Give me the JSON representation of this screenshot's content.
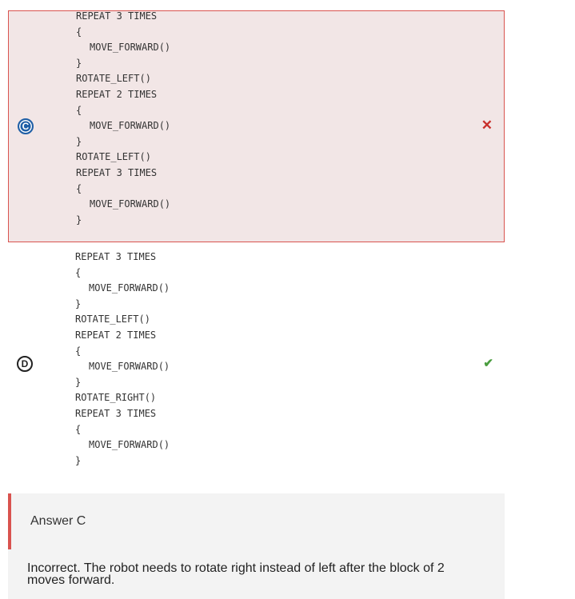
{
  "options": [
    {
      "letter": "C",
      "status": "incorrect",
      "status_icon": "cross-icon",
      "code_lines": [
        {
          "text": "REPEAT 3 TIMES",
          "indent": 0
        },
        {
          "text": "{",
          "indent": 0
        },
        {
          "text": "MOVE_FORWARD()",
          "indent": 1
        },
        {
          "text": "}",
          "indent": 0
        },
        {
          "text": "ROTATE_LEFT()",
          "indent": 0
        },
        {
          "text": "REPEAT 2 TIMES",
          "indent": 0
        },
        {
          "text": "{",
          "indent": 0
        },
        {
          "text": "MOVE_FORWARD()",
          "indent": 1
        },
        {
          "text": "}",
          "indent": 0
        },
        {
          "text": "ROTATE_LEFT()",
          "indent": 0
        },
        {
          "text": "REPEAT 3 TIMES",
          "indent": 0
        },
        {
          "text": "{",
          "indent": 0
        },
        {
          "text": "MOVE_FORWARD()",
          "indent": 1
        },
        {
          "text": "}",
          "indent": 0
        }
      ]
    },
    {
      "letter": "D",
      "status": "correct",
      "status_icon": "checkmark-icon",
      "code_lines": [
        {
          "text": "REPEAT 3 TIMES",
          "indent": 0
        },
        {
          "text": "{",
          "indent": 0
        },
        {
          "text": "MOVE_FORWARD()",
          "indent": 1
        },
        {
          "text": "}",
          "indent": 0
        },
        {
          "text": "ROTATE_LEFT()",
          "indent": 0
        },
        {
          "text": "REPEAT 2 TIMES",
          "indent": 0
        },
        {
          "text": "{",
          "indent": 0
        },
        {
          "text": "MOVE_FORWARD()",
          "indent": 1
        },
        {
          "text": "}",
          "indent": 0
        },
        {
          "text": "ROTATE_RIGHT()",
          "indent": 0
        },
        {
          "text": "REPEAT 3 TIMES",
          "indent": 0
        },
        {
          "text": "{",
          "indent": 0
        },
        {
          "text": "MOVE_FORWARD()",
          "indent": 1
        },
        {
          "text": "}",
          "indent": 0
        }
      ]
    }
  ],
  "feedback": {
    "title": "Answer C",
    "text": "Incorrect. The robot needs to rotate right instead of left after the block of 2 moves forward."
  },
  "colors": {
    "incorrect_bg": "#f2e6e6",
    "incorrect_border": "#d9534f",
    "correct_mark": "#4a9d3f",
    "incorrect_mark": "#c9302c",
    "selected_badge": "#1f5fa6"
  }
}
